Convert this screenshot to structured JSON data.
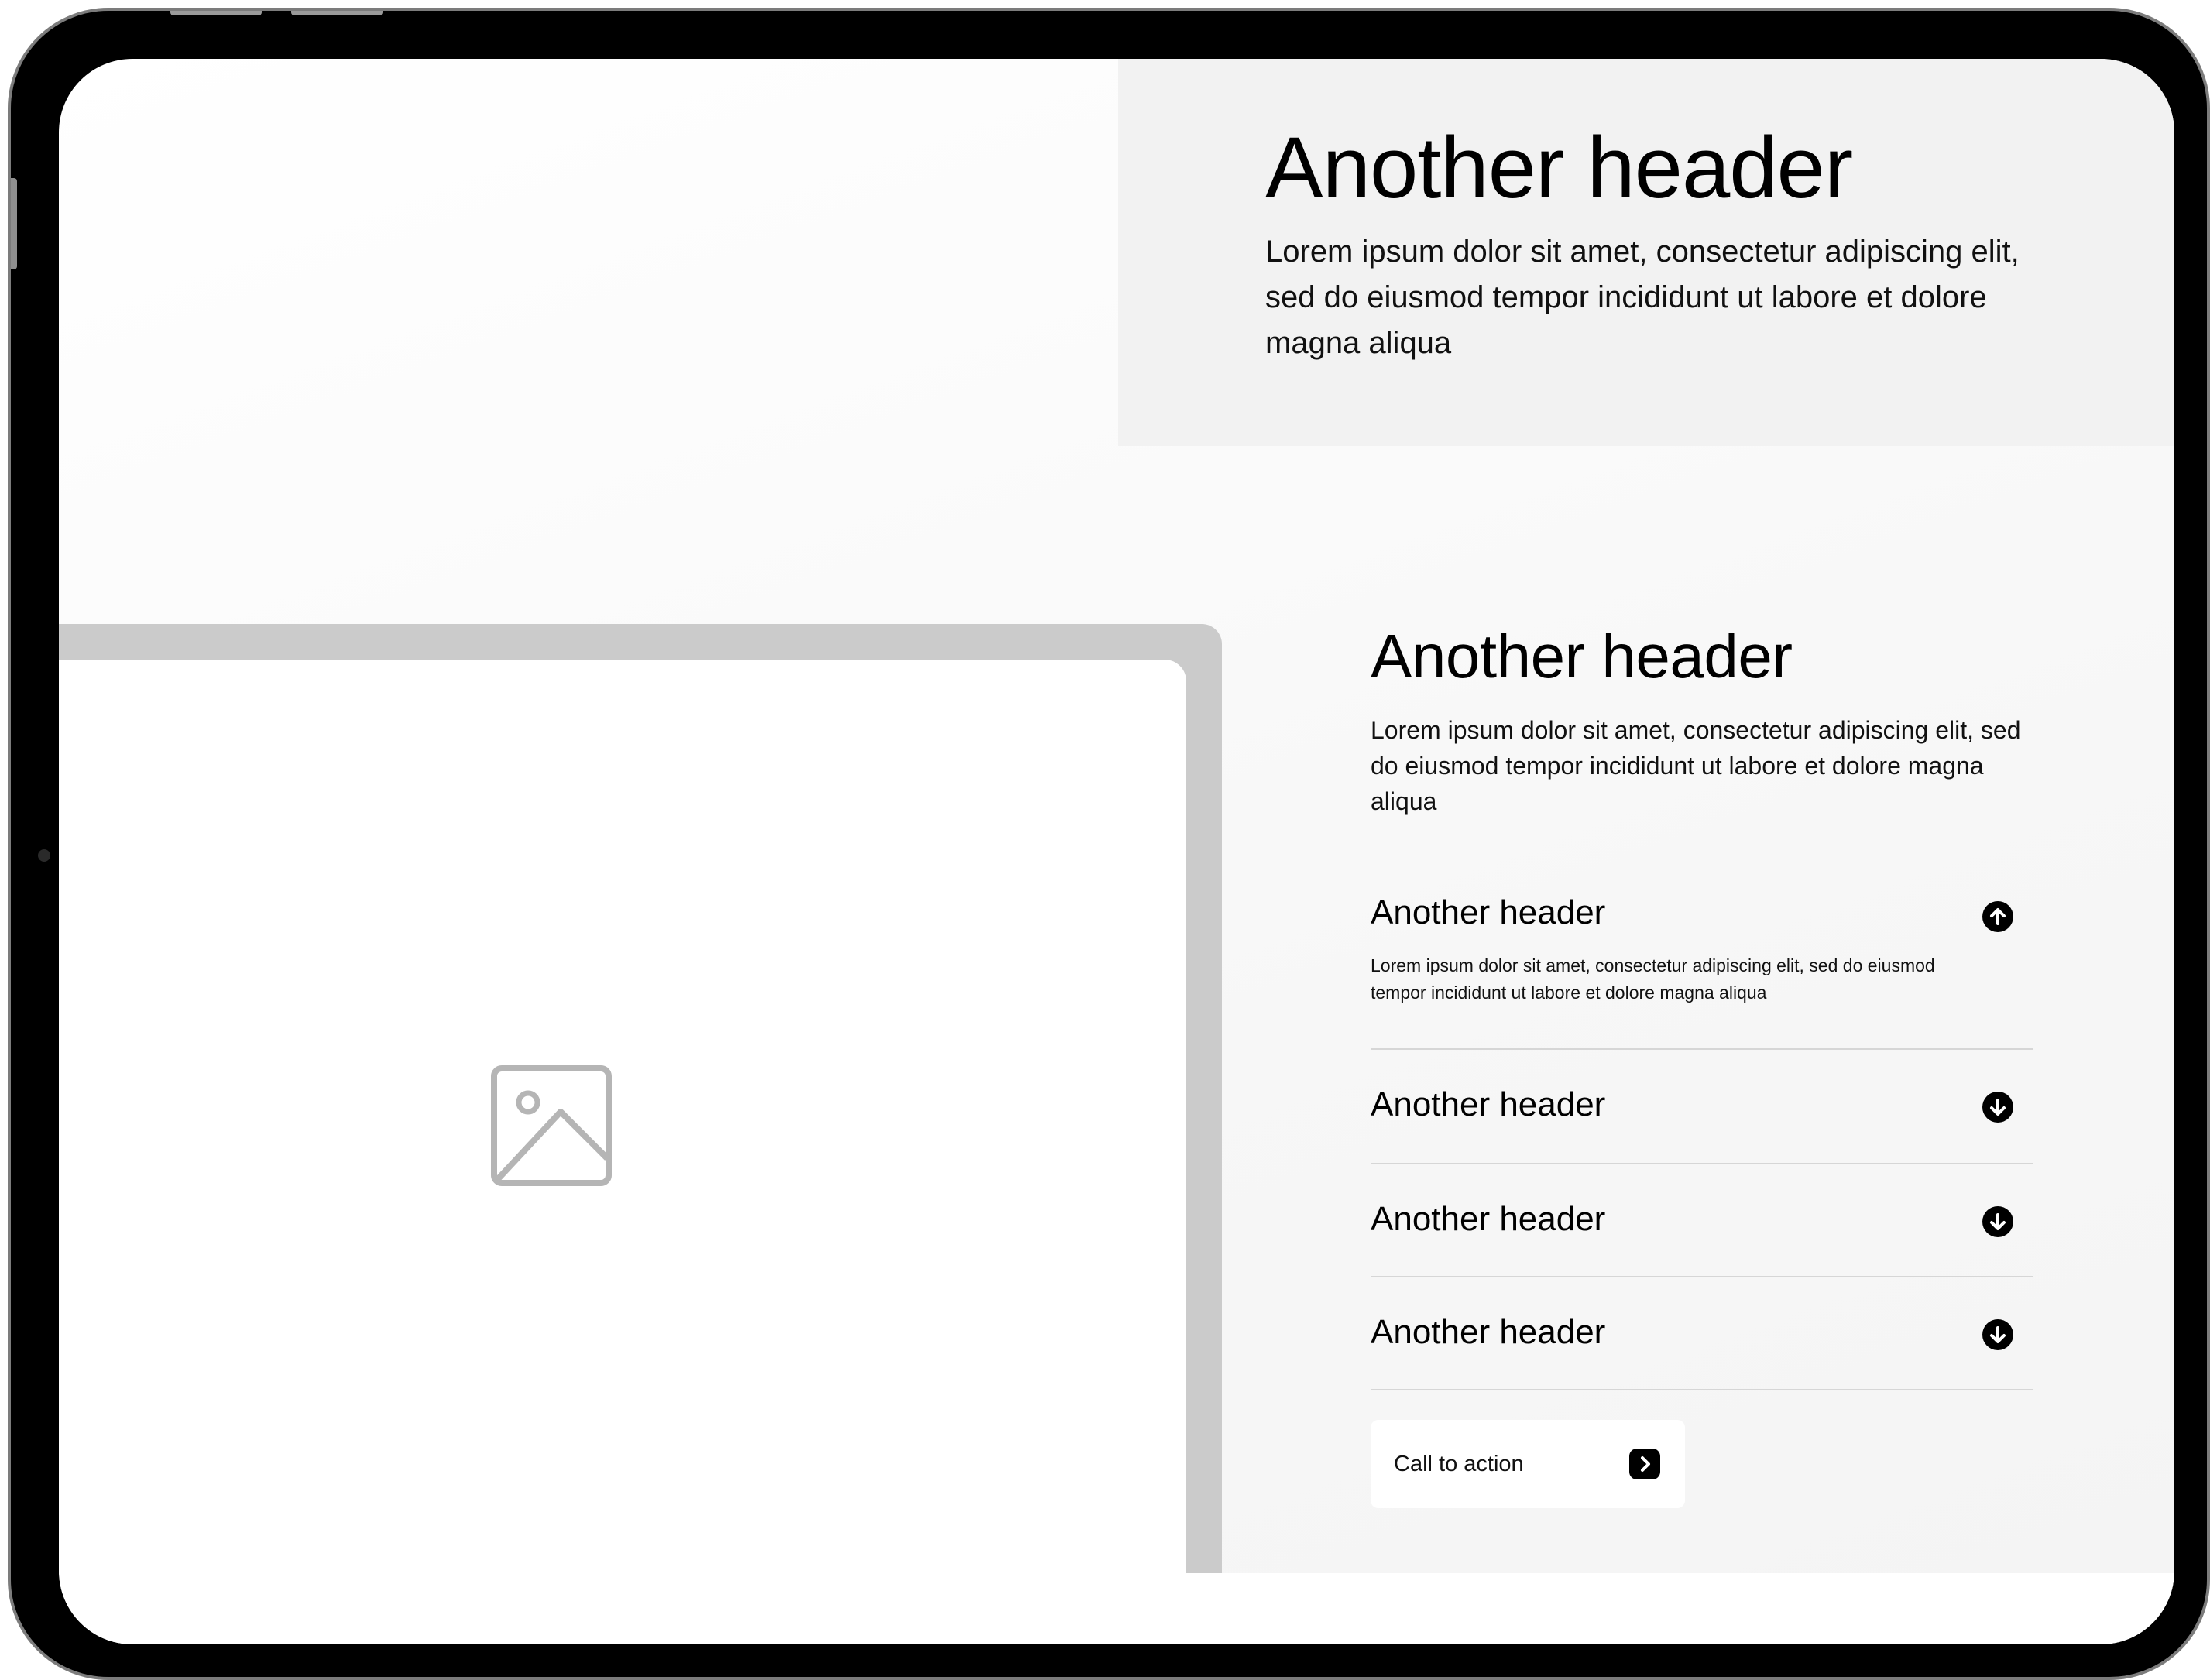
{
  "hero": {
    "title": "Another header",
    "body": "Lorem ipsum dolor sit amet, consectetur adipiscing elit, sed do eiusmod tempor incididunt ut labore et dolore magna aliqua"
  },
  "media": {
    "icon": "image-placeholder-icon"
  },
  "section": {
    "title": "Another header",
    "body": "Lorem ipsum dolor sit amet, consectetur adipiscing elit, sed do eiusmod tempor incididunt ut labore et dolore magna aliqua"
  },
  "accordion": {
    "items": [
      {
        "title": "Another header",
        "body": "Lorem ipsum dolor sit amet, consectetur adipiscing elit, sed do eiusmod tempor incididunt ut labore et dolore magna aliqua",
        "expanded": true,
        "icon": "arrow-up-circle-icon"
      },
      {
        "title": "Another header",
        "expanded": false,
        "icon": "arrow-down-circle-icon"
      },
      {
        "title": "Another header",
        "expanded": false,
        "icon": "arrow-down-circle-icon"
      },
      {
        "title": "Another header",
        "expanded": false,
        "icon": "arrow-down-circle-icon"
      }
    ]
  },
  "cta": {
    "label": "Call to action",
    "icon": "chevron-right-icon"
  },
  "colors": {
    "panel": "#f2f2f2",
    "frame": "#000000",
    "placeholder_border": "#cbcbcb",
    "icon_fill": "#000000",
    "divider": "#d6d6d6"
  }
}
